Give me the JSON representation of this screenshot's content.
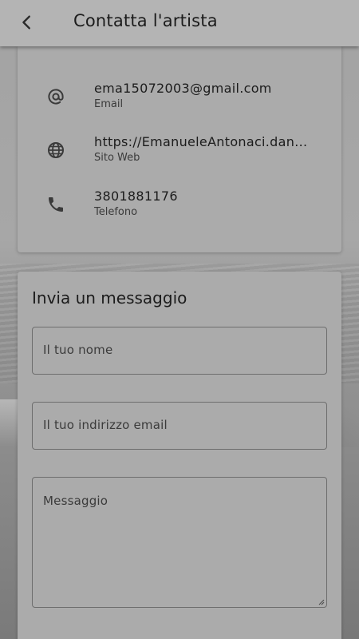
{
  "header": {
    "title": "Contatta l'artista"
  },
  "contacts": [
    {
      "icon": "at-icon",
      "value": "ema15072003@gmail.com",
      "label": "Email"
    },
    {
      "icon": "globe-icon",
      "value": "https://EmanueleAntonaci.dan...",
      "label": "Sito Web"
    },
    {
      "icon": "phone-icon",
      "value": "3801881176",
      "label": "Telefono"
    }
  ],
  "message_form": {
    "title": "Invia un messaggio",
    "name_placeholder": "Il tuo nome",
    "email_placeholder": "Il tuo indirizzo email",
    "message_placeholder": "Messaggio"
  },
  "colors": {
    "appbar": "#b4b4b4",
    "card": "#ababab",
    "text": "#1c1c1c"
  }
}
